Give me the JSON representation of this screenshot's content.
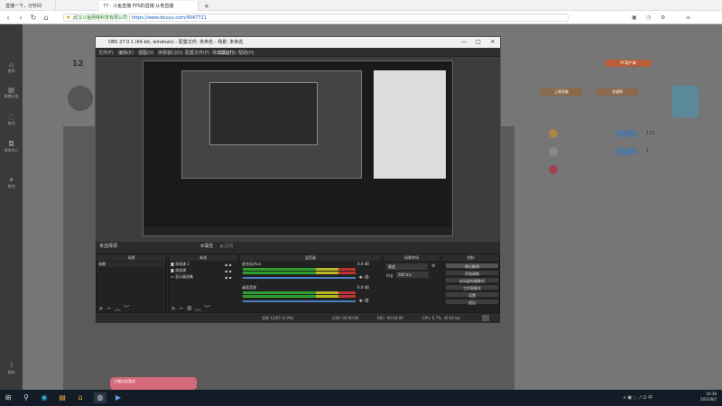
{
  "browser": {
    "tabs": [
      {
        "label": "直播一下，分秒间",
        "active": false
      },
      {
        "label": "77 · 斗鱼直播 FPS的直播 从卷直播",
        "active": true
      }
    ],
    "url_prefix": "武汉斗鱼网络科技有限公司",
    "url": "https://www.douyu.com/4047721",
    "nav": {
      "back": "‹",
      "forward": "›",
      "reload": "↻",
      "home": "⌂",
      "new_tab": "+"
    }
  },
  "page": {
    "left_nav": [
      "推荐",
      "直播分类",
      "鱼吧",
      "游戏中心",
      "鱼吧",
      "帮助"
    ],
    "level_number": "12",
    "top_btn": "PC客户端",
    "side_tabs": [
      "上周贡献",
      "金银榜"
    ],
    "side_items": [
      {
        "name": "",
        "value": "121"
      },
      {
        "name": "",
        "value": "1"
      },
      {
        "name": "",
        "value": ""
      }
    ],
    "popup": "主播比较喜欢"
  },
  "obs": {
    "title": "OBS 27.0.1 (64-bit, windows) - 配置文件: 未命名 - 场景: 未命名",
    "window_buttons": [
      "—",
      "□",
      "✕"
    ],
    "menu": [
      "文件(F)",
      "编辑(E)",
      "视图(V)",
      "停靠窗口(D)",
      "配置文件(P)",
      "场景集合(S)",
      "工具(T)",
      "帮助(H)"
    ],
    "source_label": "未选择源",
    "properties_btn": "⚙属性",
    "filters_btn": "◐滤镜",
    "scenes": {
      "title": "场景",
      "items": [
        "场景"
      ]
    },
    "sources": {
      "title": "来源",
      "items": [
        "游戏源 2",
        "游戏源",
        "显示器采集"
      ]
    },
    "mixer": {
      "title": "混音器",
      "channels": [
        {
          "name": "麦克风/Aux",
          "db": "0.0 dB"
        },
        {
          "name": "桌面音频",
          "db": "0.0 dB"
        }
      ]
    },
    "transition": {
      "title": "场景转场",
      "type": "渐变",
      "duration_label": "时长",
      "duration": "300 ms"
    },
    "controls": {
      "title": "控制",
      "buttons": [
        "停止推流",
        "开始录制",
        "启动虚拟摄像机",
        "工作室模式",
        "设置",
        "退出"
      ]
    },
    "status": {
      "drop": "丢帧 12/65 (0.0%)",
      "live": "LIVE: 00:00:00",
      "rec": "REC: 00:00:00",
      "cpu": "CPU: 0.7%, 30.00 fps"
    },
    "dock_buttons": [
      "+",
      "−",
      "⚙",
      "︿",
      "﹀"
    ]
  },
  "taskbar": {
    "time": "16:36",
    "date": "2021/8/2",
    "icons": [
      "⊞",
      "⚲",
      "⌂",
      "◉",
      "▤",
      "◍",
      "▶"
    ]
  }
}
